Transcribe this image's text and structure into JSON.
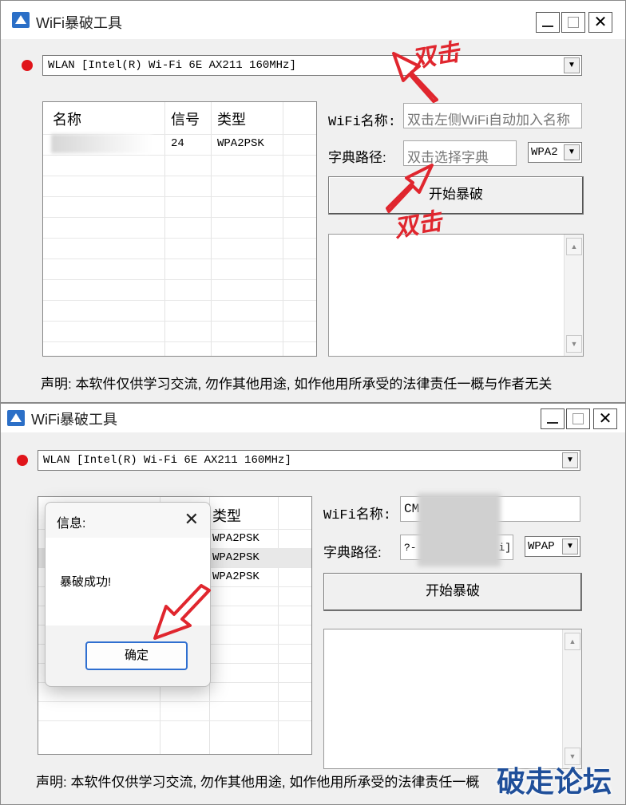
{
  "window_top": {
    "title": "WiFi暴破工具",
    "adapter_select": "WLAN [Intel(R) Wi-Fi 6E AX211 160MHz]",
    "table": {
      "headers": [
        "名称",
        "信号",
        "类型"
      ],
      "rows": [
        {
          "signal": "24",
          "type": "WPA2PSK"
        }
      ]
    },
    "wifi_name_label": "WiFi名称:",
    "wifi_name_placeholder": "双击左侧WiFi自动加入名称",
    "dict_path_label": "字典路径:",
    "dict_path_placeholder": "双击选择字典",
    "encryption_select": "WPA2",
    "start_button": "开始暴破",
    "annotation_top": "双击",
    "annotation_bottom": "双击",
    "declaration": "声明: 本软件仅供学习交流, 勿作其他用途, 如作他用所承受的法律责任一概与作者无关"
  },
  "window_bottom": {
    "title": "WiFi暴破工具",
    "adapter_select": "WLAN [Intel(R) Wi-Fi 6E AX211 160MHz]",
    "table": {
      "headers": [
        "类型"
      ],
      "rows": [
        {
          "type": "WPA2PSK"
        },
        {
          "type": "WPA2PSK"
        },
        {
          "type": "WPA2PSK"
        }
      ]
    },
    "wifi_name_label": "WiFi名称:",
    "wifi_name_value": "CM",
    "dict_path_label": "字典路径:",
    "dict_path_value_left": "?-",
    "dict_path_value_right": "i]",
    "encryption_select": "WPAP",
    "start_button": "开始暴破",
    "declaration": "声明: 本软件仅供学习交流, 勿作其他用途, 如作他用所承受的法律责任一概"
  },
  "dialog": {
    "title": "信息:",
    "message": "暴破成功!",
    "ok_button": "确定"
  },
  "watermark": "破走论坛",
  "icons": [
    "app-icon",
    "minimize-icon",
    "maximize-icon",
    "close-icon",
    "chevron-down-icon",
    "scroll-up-icon",
    "scroll-down-icon",
    "arrow-annotation-icon"
  ],
  "colors": {
    "status_dot": "#e0141a",
    "annotation": "#e0262e",
    "dialog_accent": "#2f6fd0",
    "watermark": "#1f4f9a"
  }
}
